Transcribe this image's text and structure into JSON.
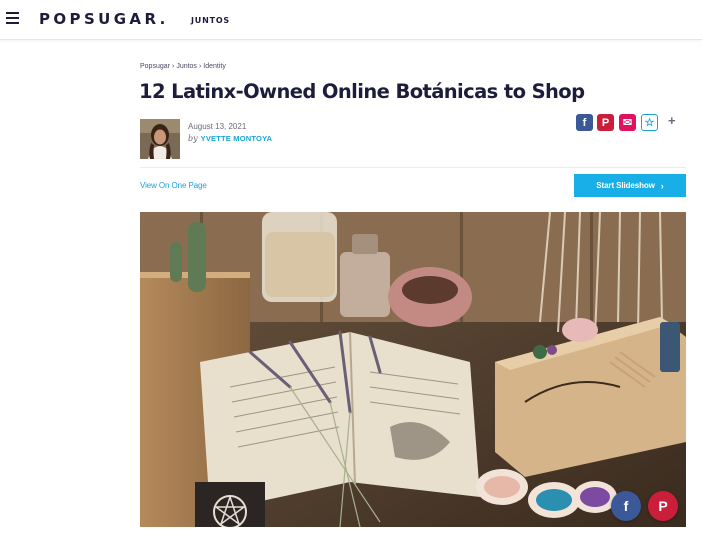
{
  "header": {
    "brand": "POPSUGAR.",
    "brand_sub": "JUNTOS",
    "menu_icon": "hamburger-icon"
  },
  "breadcrumb": [
    "Popsugar",
    "Juntos",
    "Identity"
  ],
  "article": {
    "title": "12 Latinx-Owned Online Botánicas to Shop",
    "date": "August 13, 2021",
    "by": "by",
    "author": "YVETTE MONTOYA"
  },
  "share": {
    "facebook": "f",
    "pinterest": "P",
    "email": "✉",
    "favorite": "☆",
    "more": "+"
  },
  "actions": {
    "view_one_page": "View On One Page",
    "start_slideshow": "Start Slideshow",
    "chevron": "›"
  },
  "colors": {
    "brand_navy": "#1d1d3b",
    "accent_blue": "#1aa4d6",
    "button_blue": "#18aee8",
    "facebook": "#3b5998",
    "pinterest": "#cb1e3b",
    "email": "#e0115f"
  }
}
